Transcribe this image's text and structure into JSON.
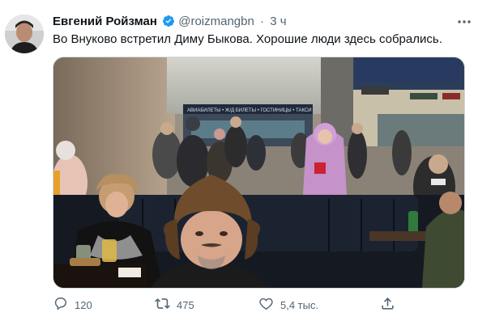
{
  "tweet": {
    "author_name": "Евгений Ройзман",
    "handle": "@roizmangbn",
    "separator": "·",
    "time": "3 ч",
    "text": "Во Внуково встретил Диму Быкова. Хорошие люди здесь собрались.",
    "verified": true
  },
  "media": {
    "signs": {
      "main": "АВИАБИЛЕТЫ • Ж/Д БИЛЕТЫ • ГОСТИНИЦЫ • ТАКСИ"
    }
  },
  "actions": {
    "reply_count": "120",
    "retweet_count": "475",
    "like_count": "5,4 тыс."
  },
  "colors": {
    "verified_badge": "#1d9bf0",
    "secondary_text": "#536471",
    "primary_text": "#0f1419"
  },
  "icons": {
    "reply": "reply-icon",
    "retweet": "retweet-icon",
    "like": "heart-icon",
    "share": "share-icon",
    "more": "more-icon",
    "verified": "verified-badge-icon"
  }
}
